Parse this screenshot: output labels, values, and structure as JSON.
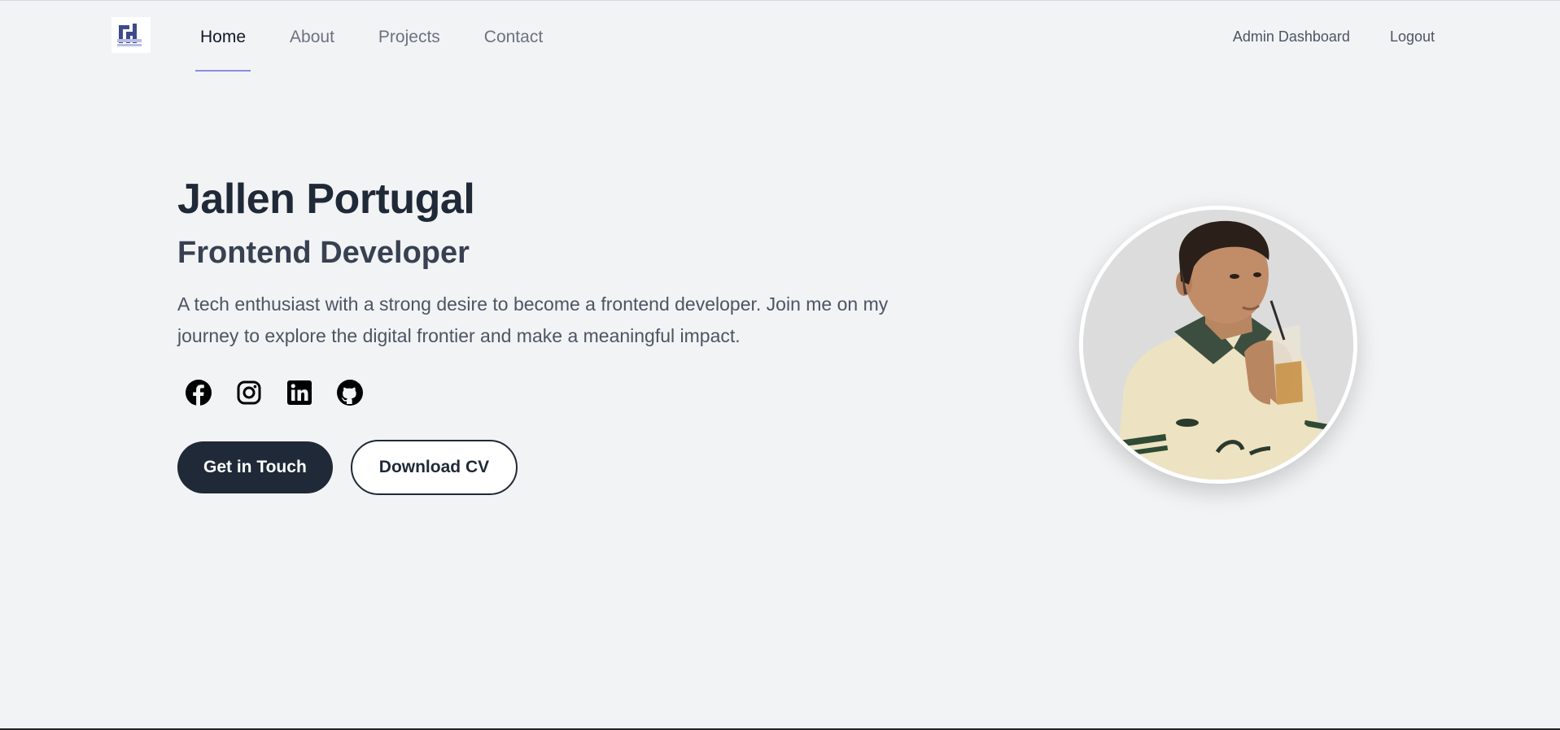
{
  "nav": {
    "logo_icon": "brand-logo-icon",
    "links": [
      {
        "label": "Home",
        "active": true
      },
      {
        "label": "About",
        "active": false
      },
      {
        "label": "Projects",
        "active": false
      },
      {
        "label": "Contact",
        "active": false
      }
    ],
    "admin_label": "Admin Dashboard",
    "logout_label": "Logout",
    "underline_color": "#8b8fe0"
  },
  "hero": {
    "name": "Jallen Portugal",
    "role": "Frontend Developer",
    "description": "A tech enthusiast with a strong desire to become a frontend developer. Join me on my journey to explore the digital frontier and make a meaningful impact.",
    "socials": [
      {
        "icon": "facebook-icon"
      },
      {
        "icon": "instagram-icon"
      },
      {
        "icon": "linkedin-icon"
      },
      {
        "icon": "github-icon"
      }
    ],
    "primary_button": "Get in Touch",
    "secondary_button": "Download CV"
  },
  "avatar": {
    "icon": "profile-photo"
  },
  "colors": {
    "background": "#f2f3f5",
    "primary": "#1f2937",
    "muted_text": "#4b5563"
  }
}
